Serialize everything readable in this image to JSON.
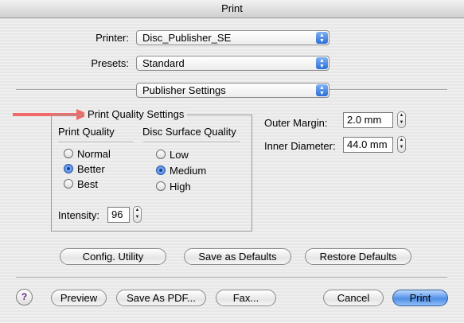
{
  "window": {
    "title": "Print"
  },
  "printer": {
    "label": "Printer:",
    "value": "Disc_Publisher_SE"
  },
  "presets": {
    "label": "Presets:",
    "value": "Standard"
  },
  "panel": {
    "value": "Publisher Settings"
  },
  "quality_group": {
    "title": "Print Quality Settings",
    "print_quality": {
      "header": "Print Quality",
      "options": [
        "Normal",
        "Better",
        "Best"
      ],
      "selected": "Better"
    },
    "disc_surface": {
      "header": "Disc Surface Quality",
      "options": [
        "Low",
        "Medium",
        "High"
      ],
      "selected": "Medium"
    },
    "intensity": {
      "label": "Intensity:",
      "value": "96"
    }
  },
  "outer_margin": {
    "label": "Outer Margin:",
    "value": "2.0 mm"
  },
  "inner_diameter": {
    "label": "Inner Diameter:",
    "value": "44.0 mm"
  },
  "buttons": {
    "config": "Config. Utility",
    "save_defaults": "Save as Defaults",
    "restore_defaults": "Restore Defaults",
    "help": "?",
    "preview": "Preview",
    "save_pdf": "Save As PDF...",
    "fax": "Fax...",
    "cancel": "Cancel",
    "print": "Print"
  },
  "colors": {
    "arrow": "#f06a6a",
    "default_button": "#4f8fe6"
  }
}
